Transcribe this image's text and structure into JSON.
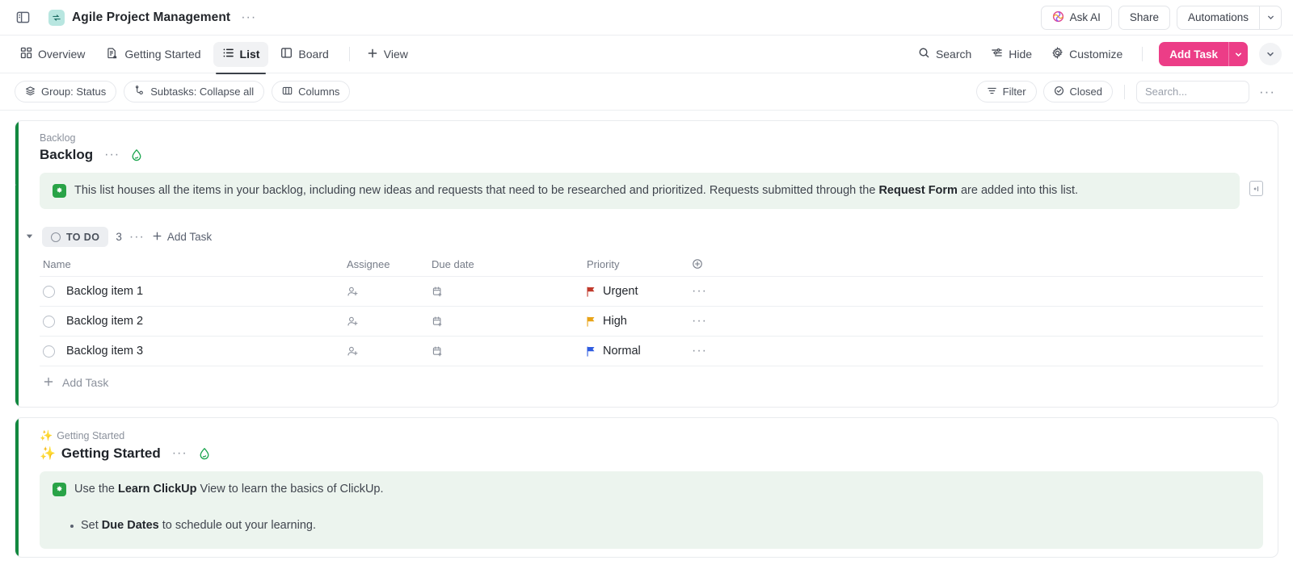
{
  "topbar": {
    "sidebar_toggle_icon": "sidebar-panel-icon",
    "logo_icon": "sync-arrows-icon",
    "title": "Agile Project Management",
    "more_dots": "···",
    "ask_ai_label": "Ask AI",
    "ask_ai_icon": "ask-ai-swirl-icon",
    "share_label": "Share",
    "automations_label": "Automations",
    "automations_caret_icon": "chevron-down-icon"
  },
  "viewbar": {
    "tabs": [
      {
        "label": "Overview",
        "icon": "grid-squares-icon",
        "active": false
      },
      {
        "label": "Getting Started",
        "icon": "document-home-icon",
        "active": false
      },
      {
        "label": "List",
        "icon": "list-icon",
        "active": true
      },
      {
        "label": "Board",
        "icon": "board-columns-icon",
        "active": false
      }
    ],
    "add_view_label": "View",
    "add_view_icon": "plus-icon",
    "search_label": "Search",
    "search_icon": "magnifier-icon",
    "hide_label": "Hide",
    "hide_icon": "sliders-icon",
    "customize_label": "Customize",
    "customize_icon": "gear-icon",
    "add_task_label": "Add Task",
    "add_task_caret_icon": "chevron-down-icon",
    "overflow_caret_icon": "chevron-down-icon",
    "accent_color": "#ec3d87"
  },
  "filterbar": {
    "group_label": "Group: Status",
    "group_icon": "layers-icon",
    "subtasks_label": "Subtasks: Collapse all",
    "subtasks_icon": "subtask-node-icon",
    "columns_label": "Columns",
    "columns_icon": "columns-icon",
    "filter_label": "Filter",
    "filter_icon": "funnel-icon",
    "closed_label": "Closed",
    "closed_icon": "check-circle-icon",
    "search_placeholder": "Search...",
    "search_value": "",
    "more_dots": "···"
  },
  "lists": [
    {
      "breadcrumb": "Backlog",
      "title": "Backlog",
      "more_dots": "···",
      "status_icon": "green-drop-icon",
      "accent_color": "#12883f",
      "banner": {
        "icon": "clickup-green-badge-icon",
        "text_1": "This list houses all the items in your backlog, including new ideas and requests that need to be researched and prioritized. Requests submitted through the ",
        "bold": "Request Form",
        "text_2": " are added into this list."
      },
      "side_collapse_icon": "collapse-panel-icon",
      "group": {
        "arrow_icon": "caret-down-icon",
        "status_label": "TO DO",
        "status_ring_icon": "status-circle-icon",
        "count": "3",
        "more_dots": "···",
        "add_task_label": "Add Task",
        "add_task_icon": "plus-icon"
      },
      "columns": {
        "name": "Name",
        "assignee": "Assignee",
        "due_date": "Due date",
        "priority": "Priority",
        "add_column_icon": "plus-circle-icon"
      },
      "tasks": [
        {
          "name": "Backlog item 1",
          "assignee": "",
          "assignee_icon": "add-person-icon",
          "due_date": "",
          "due_icon": "add-calendar-icon",
          "priority": "Urgent",
          "priority_color": "#c0392b",
          "row_dots": "···"
        },
        {
          "name": "Backlog item 2",
          "assignee": "",
          "assignee_icon": "add-person-icon",
          "due_date": "",
          "due_icon": "add-calendar-icon",
          "priority": "High",
          "priority_color": "#e8a317",
          "row_dots": "···"
        },
        {
          "name": "Backlog item 3",
          "assignee": "",
          "assignee_icon": "add-person-icon",
          "due_date": "",
          "due_icon": "add-calendar-icon",
          "priority": "Normal",
          "priority_color": "#2f5ce0",
          "row_dots": "···"
        }
      ],
      "footer_add_task": "Add Task"
    },
    {
      "breadcrumb": "Getting Started",
      "breadcrumb_emoji": "✨",
      "title": "Getting Started",
      "title_emoji": "✨",
      "more_dots": "···",
      "status_icon": "green-drop-icon",
      "accent_color": "#12883f",
      "banner": {
        "icon": "clickup-green-badge-icon",
        "text_1": "Use the ",
        "bold": "Learn ClickUp",
        "text_2": " View to learn the basics of ClickUp.",
        "bullets": [
          {
            "text_1": "Set ",
            "bold": "Due Dates",
            "text_2": " to schedule out your learning."
          }
        ]
      }
    }
  ]
}
